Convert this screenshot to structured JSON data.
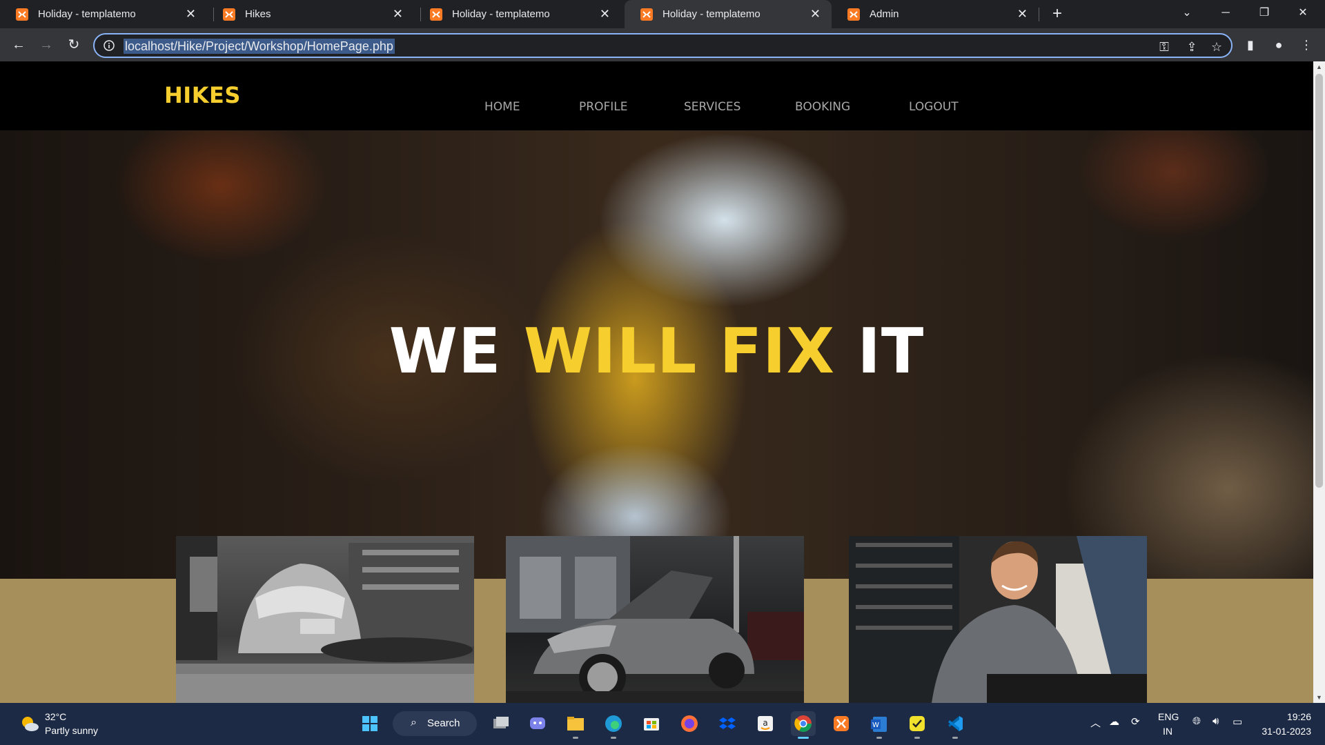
{
  "browser": {
    "tabs": [
      {
        "title": "Holiday - templatemo",
        "active": false
      },
      {
        "title": "Hikes",
        "active": false
      },
      {
        "title": "Holiday - templatemo",
        "active": false
      },
      {
        "title": "Holiday - templatemo",
        "active": true
      },
      {
        "title": "Admin",
        "active": false
      }
    ],
    "new_tab": "+",
    "url": "localhost/Hike/Project/Workshop/HomePage.php",
    "accent_color": "#8ab4f8"
  },
  "site": {
    "logo": "HIKES",
    "nav": [
      "HOME",
      "PROFILE",
      "SERVICES",
      "BOOKING",
      "LOGOUT"
    ],
    "hero": {
      "part1": "WE ",
      "accent": "WILL FIX",
      "part2": " IT"
    },
    "accent_color": "#f6cf2e",
    "band_color": "#a78f5b",
    "photos": [
      "mechanic-under-vintage-car-photo",
      "sports-car-open-hood-garage-photo",
      "smiling-mechanic-photo"
    ]
  },
  "taskbar": {
    "weather": {
      "temp": "32°C",
      "desc": "Partly sunny"
    },
    "search_label": "Search",
    "tray": {
      "lang1": "ENG",
      "lang2": "IN"
    },
    "clock": {
      "time": "19:26",
      "date": "31-01-2023"
    }
  }
}
